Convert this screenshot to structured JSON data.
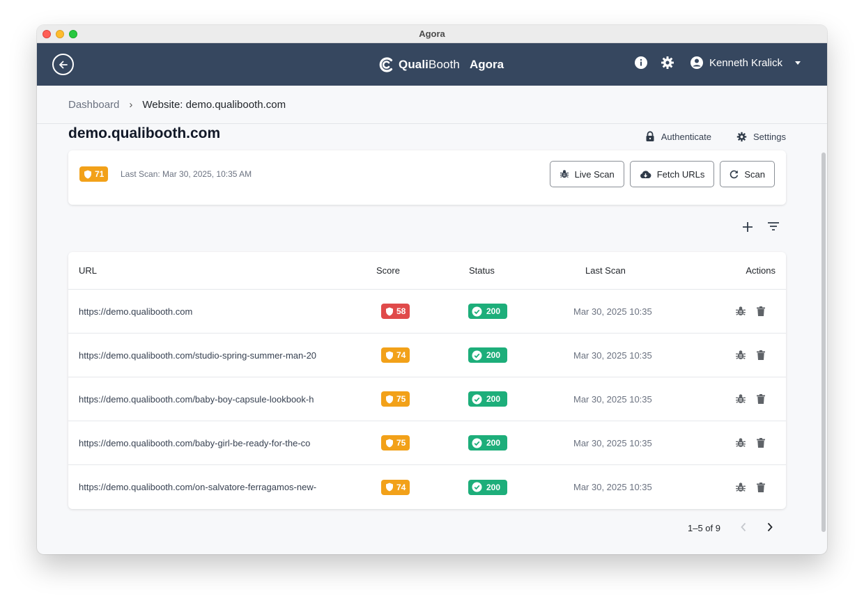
{
  "window": {
    "title": "Agora"
  },
  "appbar": {
    "brand_bold": "Quali",
    "brand_rest": "Booth",
    "brand_sub": "Agora",
    "user_name": "Kenneth Kralick"
  },
  "breadcrumb": {
    "root": "Dashboard",
    "separator": "›",
    "current": "Website: demo.qualibooth.com"
  },
  "site": {
    "title": "demo.qualibooth.com",
    "authenticate_label": "Authenticate",
    "settings_label": "Settings"
  },
  "summary": {
    "score": "71",
    "last_scan": "Last Scan: Mar 30, 2025, 10:35 AM",
    "live_scan_label": "Live Scan",
    "fetch_urls_label": "Fetch URLs",
    "scan_label": "Scan"
  },
  "table": {
    "headers": {
      "url": "URL",
      "score": "Score",
      "status": "Status",
      "last_scan": "Last Scan",
      "actions": "Actions"
    },
    "rows": [
      {
        "url": "https://demo.qualibooth.com",
        "score": "58",
        "score_color": "#e04a4a",
        "status": "200",
        "last_scan": "Mar 30, 2025 10:35"
      },
      {
        "url": "https://demo.qualibooth.com/studio-spring-summer-man-20",
        "score": "74",
        "score_color": "#f2a119",
        "status": "200",
        "last_scan": "Mar 30, 2025 10:35"
      },
      {
        "url": "https://demo.qualibooth.com/baby-boy-capsule-lookbook-h",
        "score": "75",
        "score_color": "#f2a119",
        "status": "200",
        "last_scan": "Mar 30, 2025 10:35"
      },
      {
        "url": "https://demo.qualibooth.com/baby-girl-be-ready-for-the-co",
        "score": "75",
        "score_color": "#f2a119",
        "status": "200",
        "last_scan": "Mar 30, 2025 10:35"
      },
      {
        "url": "https://demo.qualibooth.com/on-salvatore-ferragamos-new-",
        "score": "74",
        "score_color": "#f2a119",
        "status": "200",
        "last_scan": "Mar 30, 2025 10:35"
      }
    ]
  },
  "pagination": {
    "range": "1–5 of 9"
  },
  "colors": {
    "appbar": "#36475f",
    "score_amber": "#f2a119",
    "score_red": "#e04a4a",
    "status_ok": "#1dae7a"
  },
  "icons": {
    "back": "arrow-left-circle-icon",
    "info": "info-icon",
    "settings": "gear-icon",
    "user": "account-circle-icon",
    "lock": "lock-icon",
    "shield": "shield-icon",
    "bug": "bug-icon",
    "cloud": "cloud-download-icon",
    "refresh": "refresh-icon",
    "add": "plus-icon",
    "filter": "filter-icon",
    "check": "check-circle-icon",
    "delete": "trash-icon"
  }
}
